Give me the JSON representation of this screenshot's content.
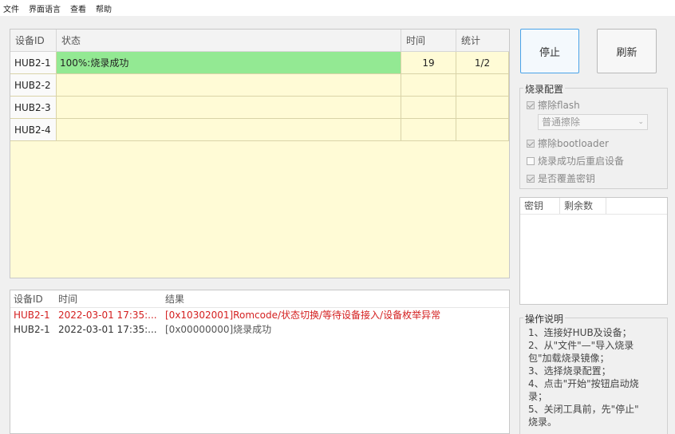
{
  "menu": [
    "文件",
    "界面语言",
    "查看",
    "帮助"
  ],
  "device_table": {
    "headers": [
      "设备ID",
      "状态",
      "时间",
      "统计"
    ],
    "rows": [
      {
        "id": "HUB2-1",
        "status": "100%:烧录成功",
        "time": "19",
        "count": "1/2",
        "ok": true
      },
      {
        "id": "HUB2-2",
        "status": "",
        "time": "",
        "count": "",
        "ok": false
      },
      {
        "id": "HUB2-3",
        "status": "",
        "time": "",
        "count": "",
        "ok": false
      },
      {
        "id": "HUB2-4",
        "status": "",
        "time": "",
        "count": "",
        "ok": false
      }
    ],
    "success_color": "#93e993",
    "background_color": "#fffbd6"
  },
  "log": {
    "headers": [
      "设备ID",
      "时间",
      "结果"
    ],
    "rows": [
      {
        "id": "HUB2-1",
        "time": "2022-03-01 17:35:...",
        "result": "[0x10302001]Romcode/状态切换/等待设备接入/设备枚举异常",
        "level": "err"
      },
      {
        "id": "HUB2-1",
        "time": "2022-03-01 17:35:...",
        "result": "[0x00000000]烧录成功",
        "level": "ok"
      }
    ],
    "error_color": "#d42020"
  },
  "buttons": {
    "stop": "停止",
    "refresh": "刷新"
  },
  "config": {
    "title": "烧录配置",
    "erase_flash": "擦除flash",
    "erase_mode": "普通擦除",
    "erase_bootloader": "擦除bootloader",
    "restart_after": "烧录成功后重启设备",
    "overwrite_key": "是否覆盖密钥"
  },
  "keys": {
    "headers": [
      "密钥",
      "剩余数"
    ]
  },
  "help": {
    "title": "操作说明",
    "lines": [
      "1、连接好HUB及设备；",
      "2、从\"文件\"—\"导入烧录",
      "包\"加载烧录镜像；",
      "3、选择烧录配置；",
      "4、点击\"开始\"按钮启动烧",
      "录；",
      "5、关闭工具前，先\"停止\"",
      "烧录。"
    ]
  }
}
